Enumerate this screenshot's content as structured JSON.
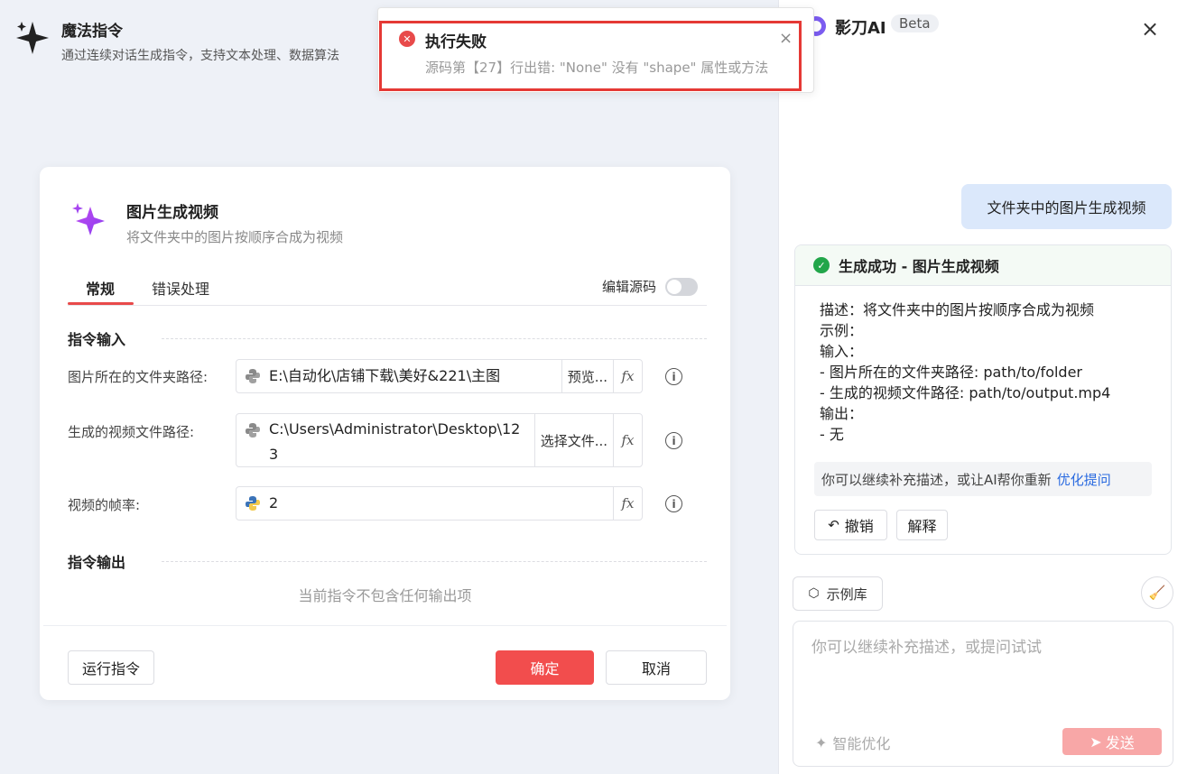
{
  "header": {
    "title": "魔法指令",
    "subtitle": "通过连续对话生成指令，支持文本处理、数据算法"
  },
  "toast": {
    "title": "执行失败",
    "message": "源码第【27】行出错: \"None\" 没有 \"shape\" 属性或方法",
    "close": "×"
  },
  "dialog": {
    "title": "图片生成视频",
    "subtitle": "将文件夹中的图片按顺序合成为视频",
    "tabs": [
      {
        "label": "常规",
        "active": true
      },
      {
        "label": "错误处理",
        "active": false
      }
    ],
    "edit_source_label": "编辑源码",
    "edit_source_on": false,
    "input_section": "指令输入",
    "fields": [
      {
        "label": "图片所在的文件夹路径:",
        "value": "E:\\自动化\\店铺下载\\美好&221\\主图",
        "button": "预览...",
        "fx": "fx"
      },
      {
        "label": "生成的视频文件路径:",
        "value": "C:\\Users\\Administrator\\Desktop\\123",
        "button": "选择文件...",
        "fx": "fx"
      },
      {
        "label": "视频的帧率:",
        "value": "2",
        "fx": "fx"
      }
    ],
    "output_section": "指令输出",
    "no_output": "当前指令不包含任何输出项",
    "run_button": "运行指令",
    "confirm_button": "确定",
    "cancel_button": "取消"
  },
  "ai_panel": {
    "name": "影刀AI",
    "badge": "Beta",
    "close": "×",
    "user_message": "文件夹中的图片生成视频",
    "result": {
      "title": "生成成功 - 图片生成视频",
      "lines": [
        "描述：将文件夹中的图片按顺序合成为视频",
        "示例：",
        "输入：",
        "- 图片所在的文件夹路径: path/to/folder",
        "- 生成的视频文件路径: path/to/output.mp4",
        "输出：",
        "- 无"
      ],
      "hint": "你可以继续补充描述，或让AI帮你重新",
      "hint_link": "优化提问",
      "undo": "撤销",
      "explain": "解释"
    },
    "example_button": "示例库",
    "input_placeholder": "你可以继续补充描述，或提问试试",
    "smart_optimize": "智能优化",
    "send": "发送"
  },
  "colors": {
    "accent_red": "#f24d4d",
    "success_green": "#22a64a",
    "link_blue": "#2b6be0",
    "brand_purple": "#7b5cf0"
  }
}
